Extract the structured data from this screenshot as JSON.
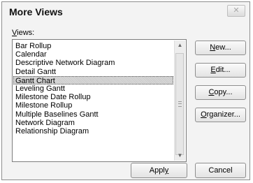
{
  "dialog": {
    "title": "More Views",
    "close_label": "✕",
    "views_label_underlined": "V",
    "views_label_rest": "iews:"
  },
  "views": [
    {
      "label": "Bar Rollup",
      "selected": false
    },
    {
      "label": "Calendar",
      "selected": false
    },
    {
      "label": "Descriptive Network Diagram",
      "selected": false
    },
    {
      "label": "Detail Gantt",
      "selected": false
    },
    {
      "label": "Gantt Chart",
      "selected": true
    },
    {
      "label": "Leveling Gantt",
      "selected": false
    },
    {
      "label": "Milestone Date Rollup",
      "selected": false
    },
    {
      "label": "Milestone Rollup",
      "selected": false
    },
    {
      "label": "Multiple Baselines Gantt",
      "selected": false
    },
    {
      "label": "Network Diagram",
      "selected": false
    },
    {
      "label": "Relationship Diagram",
      "selected": false
    }
  ],
  "buttons": {
    "new": {
      "underlined": "N",
      "rest": "ew..."
    },
    "edit": {
      "underlined": "E",
      "rest": "dit..."
    },
    "copy": {
      "underlined": "C",
      "rest": "opy..."
    },
    "organizer": {
      "underlined": "O",
      "rest": "rganizer..."
    },
    "apply": {
      "before": "Appl",
      "underlined": "y"
    },
    "cancel": {
      "label": "Cancel"
    }
  }
}
